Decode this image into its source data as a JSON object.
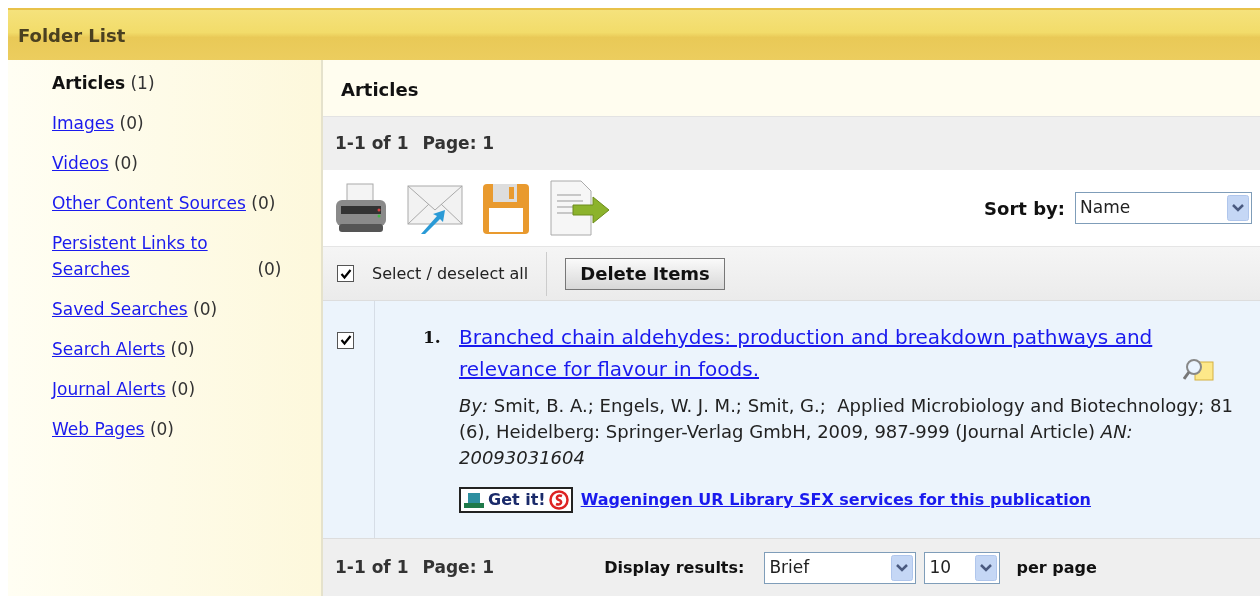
{
  "header": {
    "title": "Folder List"
  },
  "sidebar": {
    "items": [
      {
        "label": "Articles",
        "count": "(1)",
        "selected": true
      },
      {
        "label": "Images",
        "count": "(0)",
        "selected": false
      },
      {
        "label": "Videos",
        "count": "(0)",
        "selected": false
      },
      {
        "label": "Other Content Sources",
        "count": "(0)",
        "selected": false
      },
      {
        "label": "Persistent Links to Searches",
        "count": "(0)",
        "selected": false
      },
      {
        "label": "Saved Searches",
        "count": "(0)",
        "selected": false
      },
      {
        "label": "Search Alerts",
        "count": "(0)",
        "selected": false
      },
      {
        "label": "Journal Alerts",
        "count": "(0)",
        "selected": false
      },
      {
        "label": "Web Pages",
        "count": "(0)",
        "selected": false
      }
    ]
  },
  "main": {
    "title": "Articles",
    "pagination_top": {
      "range": "1-1 of 1",
      "page": "Page: 1"
    },
    "sort": {
      "label": "Sort by:",
      "value": "Name"
    },
    "select_all": {
      "label": "Select / deselect all",
      "checked": true
    },
    "delete_button": "Delete Items",
    "results": [
      {
        "number": "1.",
        "checked": true,
        "title": "Branched chain aldehydes: production and breakdown pathways and relevance for flavour in foods.",
        "by_label": "By:",
        "citation": "Smit, B. A.; Engels, W. J. M.; Smit, G.;  Applied Microbiology and Biotechnology; 81 (6), Heidelberg: Springer-Verlag GmbH, 2009, 987-999 (Journal Article)",
        "an": "AN: 20093031604",
        "getit": "Get it!",
        "sfx_link": "Wageningen UR Library SFX services for this publication"
      }
    ],
    "pagination_bottom": {
      "range": "1-1 of 1",
      "page": "Page: 1"
    },
    "display": {
      "label": "Display results:",
      "format": "Brief",
      "per_page": "10",
      "per_page_label": "per page"
    }
  }
}
